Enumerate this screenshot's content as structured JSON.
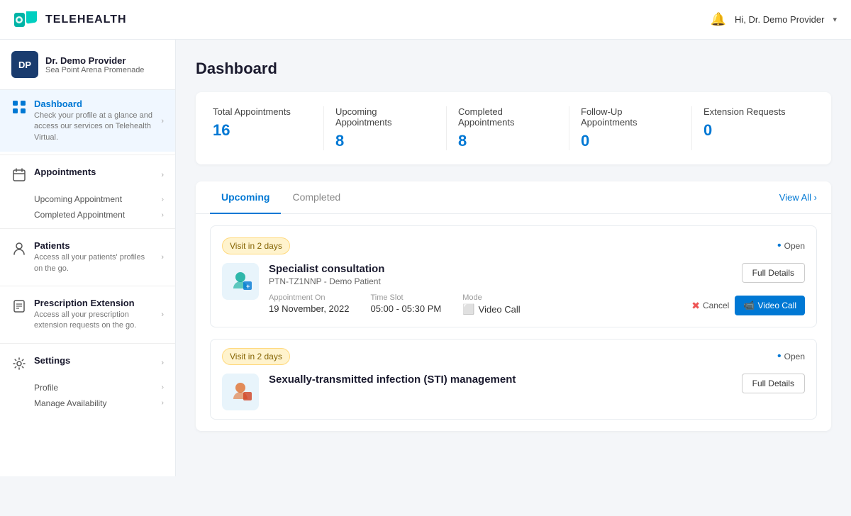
{
  "header": {
    "logo_text": "TELEHEALTH",
    "user_greeting": "Hi, Dr. Demo Provider",
    "chevron": "▾"
  },
  "sidebar": {
    "profile": {
      "initials": "DP",
      "name": "Dr. Demo Provider",
      "location": "Sea Point Arena Promenade"
    },
    "nav_items": [
      {
        "id": "dashboard",
        "label": "Dashboard",
        "desc": "Check your profile at a glance and access our services on Telehealth Virtual.",
        "active": true,
        "subitems": []
      },
      {
        "id": "appointments",
        "label": "Appointments",
        "desc": "",
        "active": false,
        "subitems": [
          "Upcoming Appointment",
          "Completed Appointment"
        ]
      },
      {
        "id": "patients",
        "label": "Patients",
        "desc": "Access all your patients' profiles on the go.",
        "active": false,
        "subitems": []
      },
      {
        "id": "prescription",
        "label": "Prescription Extension",
        "desc": "Access all your prescription extension requests on the go.",
        "active": false,
        "subitems": []
      },
      {
        "id": "settings",
        "label": "Settings",
        "desc": "",
        "active": false,
        "subitems": [
          "Profile",
          "Manage Availability"
        ]
      }
    ]
  },
  "main": {
    "page_title": "Dashboard",
    "stats": {
      "total_appointments_label": "Total Appointments",
      "total_appointments_value": "16",
      "upcoming_appointments_label": "Upcoming Appointments",
      "upcoming_appointments_value": "8",
      "completed_appointments_label": "Completed Appointments",
      "completed_appointments_value": "8",
      "followup_appointments_label": "Follow-Up Appointments",
      "followup_appointments_value": "0",
      "extension_requests_label": "Extension Requests",
      "extension_requests_value": "0"
    },
    "tabs": {
      "upcoming_label": "Upcoming",
      "completed_label": "Completed",
      "view_all_label": "View All ›"
    },
    "appointments": [
      {
        "badge": "Visit in 2 days",
        "status": "Open",
        "title": "Specialist consultation",
        "patient": "PTN-TZ1NNP - Demo Patient",
        "date_label": "Appointment On",
        "date_value": "19 November, 2022",
        "time_label": "Time Slot",
        "time_value": "05:00 - 05:30 PM",
        "mode_label": "Mode",
        "mode_value": "Video Call",
        "btn_full_details": "Full Details",
        "btn_cancel": "Cancel",
        "btn_video_call": "Video Call"
      },
      {
        "badge": "Visit in 2 days",
        "status": "Open",
        "title": "Sexually-transmitted infection (STI) management",
        "patient": "",
        "date_label": "",
        "date_value": "",
        "time_label": "",
        "time_value": "",
        "mode_label": "",
        "mode_value": "",
        "btn_full_details": "Full Details",
        "btn_cancel": "",
        "btn_video_call": ""
      }
    ]
  }
}
